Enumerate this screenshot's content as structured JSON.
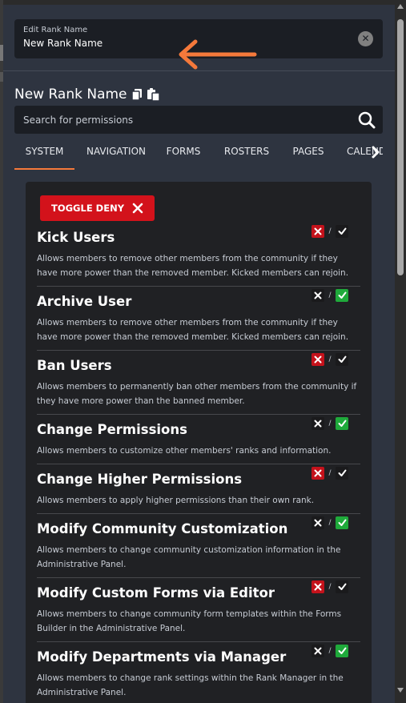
{
  "rank_field": {
    "label": "Edit Rank Name",
    "value": "New Rank Name"
  },
  "rank_title": "New Rank Name",
  "search": {
    "placeholder": "Search for permissions"
  },
  "tabs": [
    {
      "label": "SYSTEM",
      "active": true
    },
    {
      "label": "NAVIGATION",
      "active": false
    },
    {
      "label": "FORMS",
      "active": false
    },
    {
      "label": "ROSTERS",
      "active": false
    },
    {
      "label": "PAGES",
      "active": false
    },
    {
      "label": "CALENDAR",
      "active": false
    }
  ],
  "toggle_deny_label": "TOGGLE DENY",
  "permissions": [
    {
      "name": "Kick Users",
      "description": "Allows members to remove other members from the community if they have more power than the removed member. Kicked members can rejoin.",
      "state": "deny"
    },
    {
      "name": "Archive User",
      "description": "Allows members to remove other members from the community if they have more power than the removed member. Kicked members can rejoin.",
      "state": "allow"
    },
    {
      "name": "Ban Users",
      "description": "Allows members to permanently ban other members from the community if they have more power than the banned member.",
      "state": "deny"
    },
    {
      "name": "Change Permissions",
      "description": "Allows members to customize other members' ranks and information.",
      "state": "allow"
    },
    {
      "name": "Change Higher Permissions",
      "description": "Allows members to apply higher permissions than their own rank.",
      "state": "deny"
    },
    {
      "name": "Modify Community Customization",
      "description": "Allows members to change community customization information in the Administrative Panel.",
      "state": "allow"
    },
    {
      "name": "Modify Custom Forms via Editor",
      "description": "Allows members to change community form templates within the Forms Builder in the Administrative Panel.",
      "state": "deny"
    },
    {
      "name": "Modify Departments via Manager",
      "description": "Allows members to change rank settings within the Rank Manager in the Administrative Panel.",
      "state": "allow"
    }
  ],
  "colors": {
    "accent": "#f5793b",
    "deny": "#c4121b",
    "allow": "#1faa3b",
    "panel": "#2e3440",
    "list_bg": "#202124"
  },
  "icons": {
    "clear": "close-circle-icon",
    "annotation": "arrow-left-icon",
    "copy": "copy-icon",
    "paste": "paste-icon",
    "search": "search-icon",
    "tabs_scroll": "chevron-right-icon",
    "deny": "x-icon",
    "allow": "check-icon"
  }
}
